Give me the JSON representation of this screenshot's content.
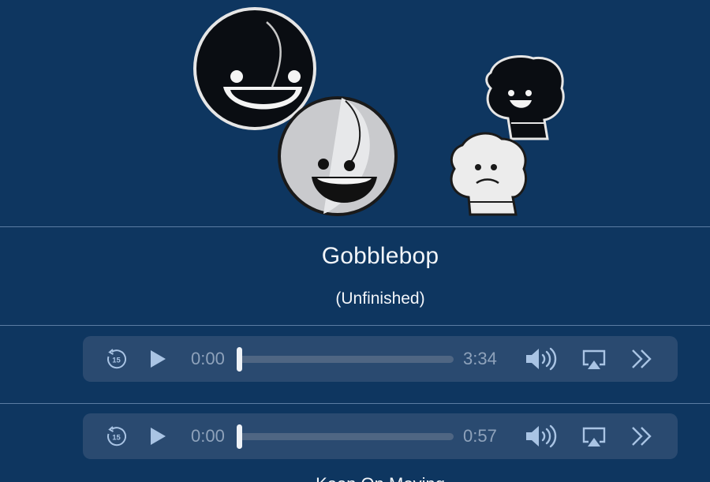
{
  "song": {
    "title": "Gobblebop",
    "subtitle": "(Unfinished)"
  },
  "players": [
    {
      "current_time": "0:00",
      "duration": "3:34",
      "progress": 0,
      "skip_seconds": "15"
    },
    {
      "current_time": "0:00",
      "duration": "0:57",
      "progress": 0,
      "skip_seconds": "15"
    }
  ],
  "next_song": {
    "title": "Keep On Moving"
  },
  "colors": {
    "background": "#0e3660",
    "player_background": "#2a4a70",
    "icon": "#a9c4e4",
    "text_muted": "#8ea2bb"
  },
  "icons": {
    "skip_back": "rewind-15-icon",
    "play": "play-icon",
    "volume": "volume-icon",
    "airplay": "airplay-icon",
    "more": "chevron-double-right-icon"
  }
}
